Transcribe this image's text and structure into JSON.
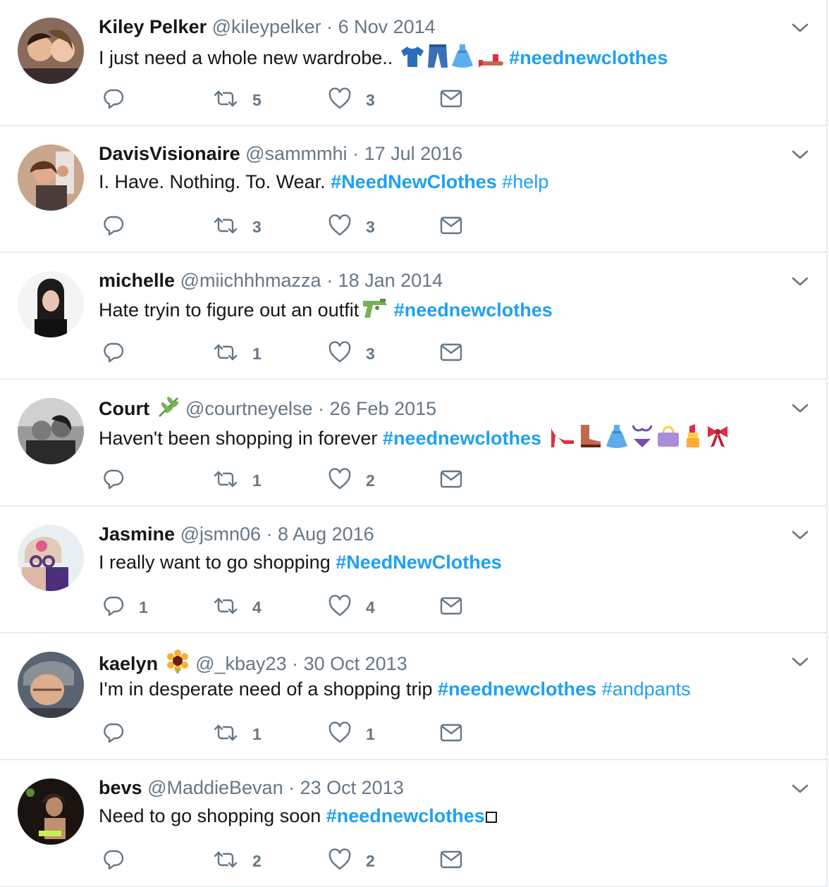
{
  "colors": {
    "accent": "#1da1f2",
    "muted": "#657786",
    "divider": "#e6ecf0"
  },
  "tweets": [
    {
      "name": "Kiley Pelker",
      "handle": "@kileypelker",
      "date": "· 6 Nov 2014",
      "text": "I just need a whole new wardrobe.. ",
      "emojis": [
        "t-shirt",
        "jeans",
        "dress",
        "sandal"
      ],
      "hashtags": [
        {
          "tag": "#neednewclothes",
          "bold": true
        }
      ],
      "replies": "",
      "retweets": "5",
      "likes": "3"
    },
    {
      "name": "DavisVisionaire",
      "handle": "@sammmhi",
      "date": "· 17 Jul 2016",
      "text": "I. Have. Nothing. To. Wear. ",
      "emojis": [],
      "hashtags": [
        {
          "tag": "#NeedNewClothes",
          "bold": true
        },
        {
          "tag": "#help",
          "bold": false
        }
      ],
      "replies": "",
      "retweets": "3",
      "likes": "3"
    },
    {
      "name": "michelle",
      "handle": "@miichhhmazza",
      "date": "· 18 Jan 2014",
      "text": "Hate tryin to figure out an outfit",
      "emojis": [
        "water-pistol"
      ],
      "hashtags": [
        {
          "tag": "#neednewclothes",
          "bold": true
        }
      ],
      "replies": "",
      "retweets": "1",
      "likes": "3"
    },
    {
      "name": "Court",
      "name_emoji": "herb",
      "handle": "@courtneyelse",
      "date": "· 26 Feb 2015",
      "text": "Haven't been shopping in forever ",
      "emojis_after": [
        "high-heel",
        "boot",
        "dress",
        "bikini",
        "handbag",
        "lipstick",
        "ribbon"
      ],
      "hashtags": [
        {
          "tag": "#neednewclothes",
          "bold": true
        }
      ],
      "replies": "",
      "retweets": "1",
      "likes": "2"
    },
    {
      "name": "Jasmine",
      "handle": "@jsmn06",
      "date": "· 8 Aug 2016",
      "text": "I really want to go shopping ",
      "emojis": [],
      "hashtags": [
        {
          "tag": "#NeedNewClothes",
          "bold": true
        }
      ],
      "replies": "1",
      "retweets": "4",
      "likes": "4"
    },
    {
      "name": "kaelyn",
      "name_emoji": "sunflower",
      "handle": "@_kbay23",
      "date": "· 30 Oct 2013",
      "text": "I'm in desperate need of a shopping trip ",
      "emojis": [],
      "hashtags": [
        {
          "tag": "#neednewclothes",
          "bold": true
        },
        {
          "tag": "#andpants",
          "bold": false
        }
      ],
      "replies": "",
      "retweets": "1",
      "likes": "1"
    },
    {
      "name": "bevs",
      "handle": "@MaddieBevan",
      "date": "· 23 Oct 2013",
      "text": "Need to go shopping soon ",
      "emojis": [],
      "hashtags": [
        {
          "tag": "#neednewclothes",
          "bold": true
        }
      ],
      "trailing_glyph": "□",
      "replies": "",
      "retweets": "2",
      "likes": "2"
    }
  ]
}
